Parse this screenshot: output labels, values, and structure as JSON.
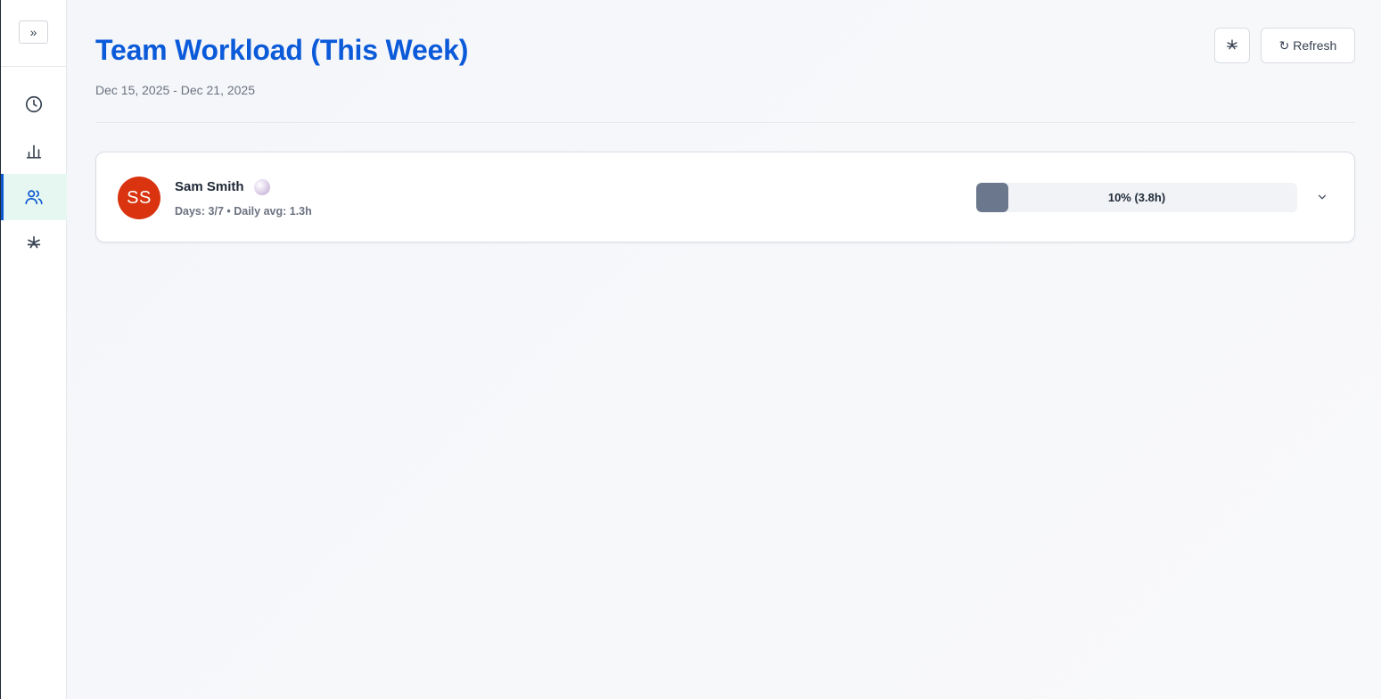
{
  "sidebar": {
    "expand_label": "»",
    "items": [
      {
        "icon": "clock-icon",
        "active": false
      },
      {
        "icon": "bar-chart-icon",
        "active": false
      },
      {
        "icon": "users-icon",
        "active": true
      },
      {
        "icon": "slack-asterisk-icon",
        "active": false
      }
    ]
  },
  "header": {
    "title": "Team Workload (This Week)",
    "date_range": "Dec 15, 2025 - Dec 21, 2025",
    "refresh_label": "↻ Refresh"
  },
  "members": [
    {
      "initials": "SS",
      "name": "Sam Smith",
      "stats": "Days: 3/7 • Daily avg: 1.3h",
      "progress_label": "10% (3.8h)",
      "progress_fraction": 0.1
    }
  ],
  "colors": {
    "accent": "#0b5ad9",
    "avatar": "#d9340f",
    "progress_fill": "#6b778c",
    "active_nav_bg": "#e6f7f1"
  }
}
